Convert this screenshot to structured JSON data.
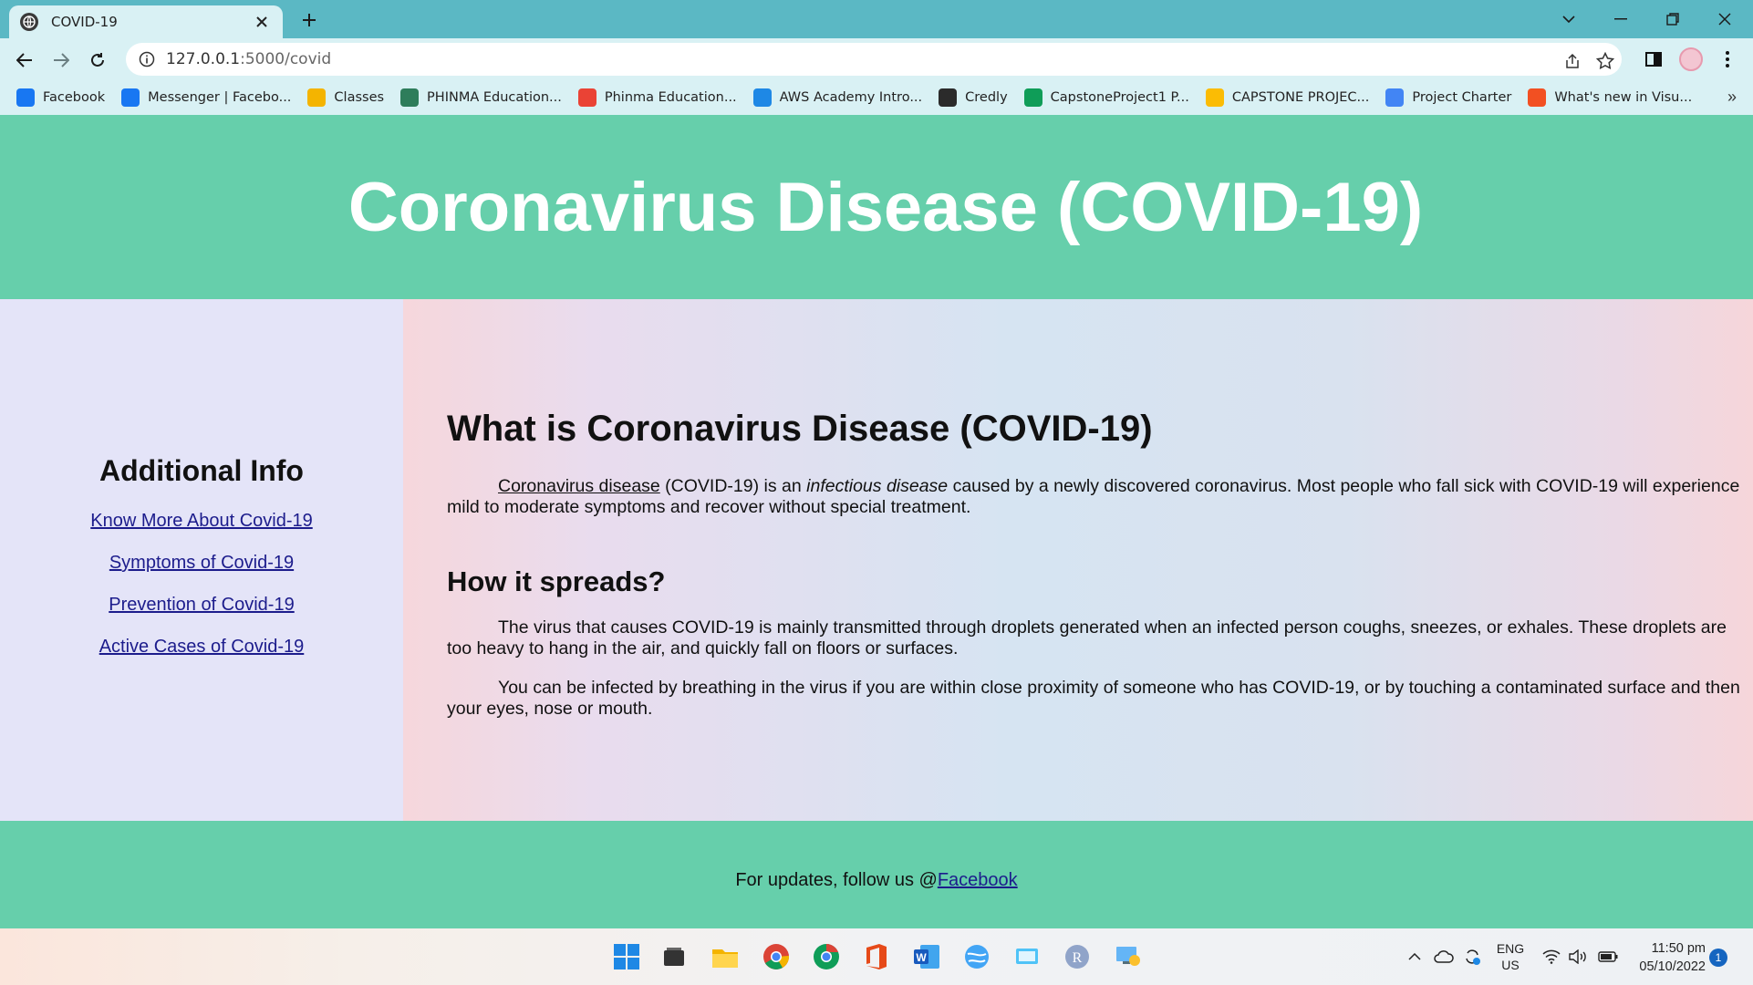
{
  "browser": {
    "tab_title": "COVID-19",
    "url_host": "127.0.0.1",
    "url_path": ":5000/covid",
    "bookmarks": [
      {
        "label": "Facebook",
        "icon": "facebook-icon",
        "color": "#1877f2"
      },
      {
        "label": "Messenger | Facebo...",
        "icon": "facebook-icon",
        "color": "#1877f2"
      },
      {
        "label": "Classes",
        "icon": "classroom-icon",
        "color": "#f4b400"
      },
      {
        "label": "PHINMA Education...",
        "icon": "globe-icon",
        "color": "#2e7d5b"
      },
      {
        "label": "Phinma Education...",
        "icon": "gmail-icon",
        "color": "#ea4335"
      },
      {
        "label": "AWS Academy Intro...",
        "icon": "cloud-icon",
        "color": "#1e88e5"
      },
      {
        "label": "Credly",
        "icon": "credly-icon",
        "color": "#2b2b2b"
      },
      {
        "label": "CapstoneProject1 P...",
        "icon": "sheets-icon",
        "color": "#0f9d58"
      },
      {
        "label": "CAPSTONE PROJEC...",
        "icon": "drive-icon",
        "color": "#fbbc04"
      },
      {
        "label": "Project Charter",
        "icon": "contacts-icon",
        "color": "#4285f4"
      },
      {
        "label": "What's new in Visu...",
        "icon": "microsoft-icon",
        "color": "#f25022"
      }
    ]
  },
  "page": {
    "header_title": "Coronavirus Disease (COVID-19)",
    "sidebar": {
      "heading": "Additional Info",
      "links": [
        "Know More About Covid-19",
        "Symptoms of Covid-19",
        "Prevention of Covid-19",
        "Active Cases of Covid-19"
      ]
    },
    "main": {
      "heading": "What is Coronavirus Disease (COVID-19)",
      "intro_link": "Coronavirus disease",
      "intro_mid": " (COVID-19) is an ",
      "intro_em": "infectious disease",
      "intro_rest": " caused by a newly discovered coronavirus. Most people who fall sick with COVID-19 will experience mild to moderate symptoms and recover without special treatment.",
      "spread_heading": "How it spreads?",
      "spread_p1": "The virus that causes COVID-19 is mainly transmitted through droplets generated when an infected person coughs, sneezes, or exhales. These droplets are too heavy to hang in the air, and quickly fall on floors or surfaces.",
      "spread_p2": "You can be infected by breathing in the virus if you are within close proximity of someone who has COVID-19, or by touching a contaminated surface and then your eyes, nose or mouth."
    },
    "footer": {
      "text": "For updates, follow us @",
      "link": "Facebook"
    }
  },
  "taskbar": {
    "lang_top": "ENG",
    "lang_bottom": "US",
    "time": "11:50 pm",
    "date": "05/10/2022",
    "notification_count": "1"
  }
}
